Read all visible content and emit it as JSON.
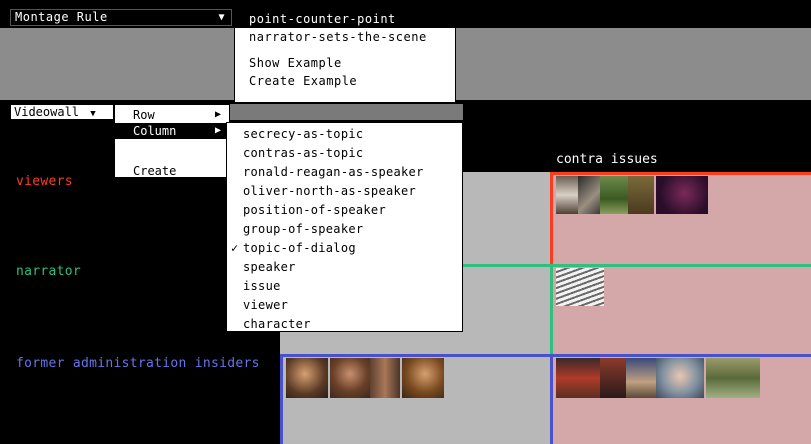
{
  "montage": {
    "label": "Montage Rule",
    "menu": [
      "point-counter-point",
      "narrator-sets-the-scene",
      "",
      "Show Example",
      "Create Example"
    ]
  },
  "videowall": {
    "label": "Videowall",
    "menu": {
      "row": "Row",
      "column": "Column",
      "create": "Create"
    },
    "column_options": [
      "secrecy-as-topic",
      "contras-as-topic",
      "ronald-reagan-as-speaker",
      "oliver-north-as-speaker",
      "position-of-speaker",
      "group-of-speaker",
      "topic-of-dialog",
      "speaker",
      "issue",
      "viewer",
      "character"
    ],
    "checked_option": "✓"
  },
  "grid": {
    "column_header": "contra issues",
    "rows": [
      {
        "label": "viewers",
        "color": "#ff3b1f"
      },
      {
        "label": "narrator",
        "color": "#2fbf7f"
      },
      {
        "label": "former administration insiders",
        "color": "#4a52c9"
      }
    ]
  }
}
